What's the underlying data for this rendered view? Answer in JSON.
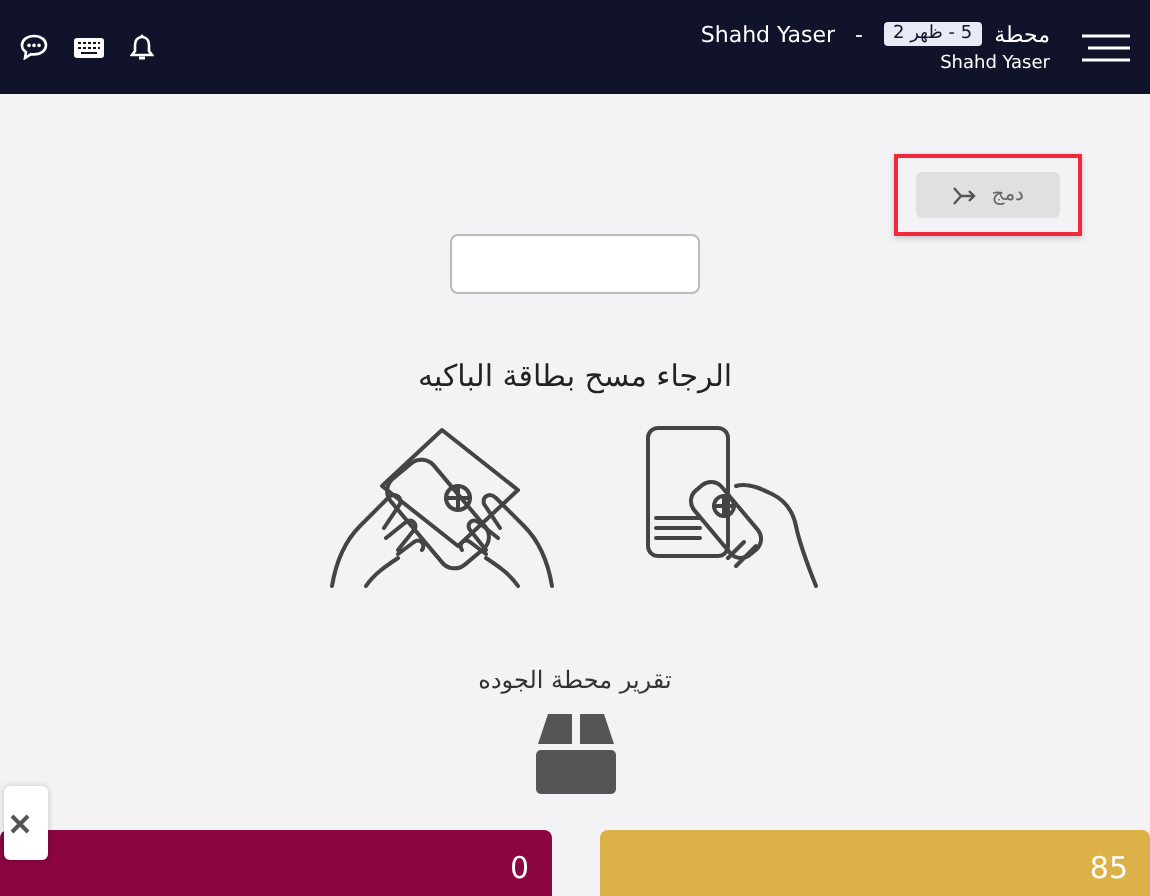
{
  "header": {
    "station_label": "محطة",
    "station_badge": "5 - ظهر 2",
    "separator": "-",
    "user_name": "Shahd Yaser",
    "subtitle": "Shahd Yaser"
  },
  "merge_button": {
    "label": "دمج",
    "highlighted": true
  },
  "prompt": "الرجاء مسح بطاقة الباكيه",
  "report_link": "تقرير محطة الجوده",
  "cards": [
    {
      "value": "85",
      "color": "#dcb248"
    },
    {
      "value": "0",
      "color": "#8b0540"
    }
  ]
}
